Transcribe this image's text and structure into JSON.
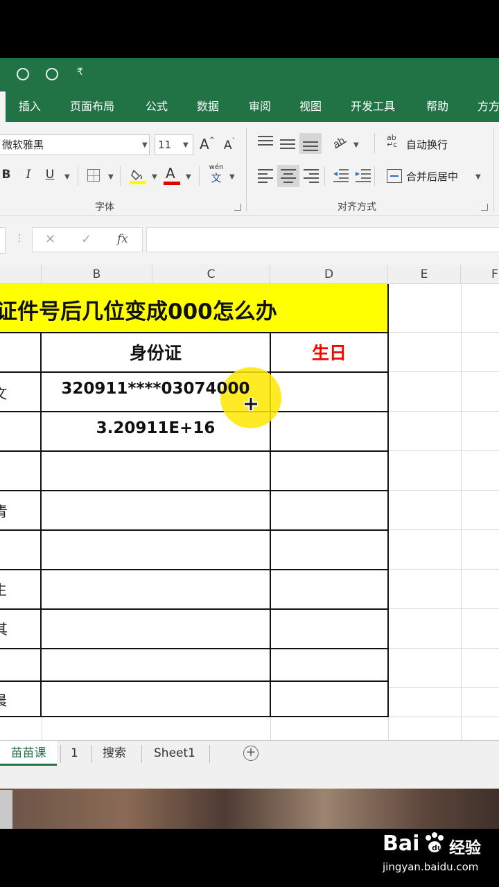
{
  "titlebar": {
    "quick_access_more": "₹"
  },
  "ribbon_tabs": [
    "插入",
    "页面布局",
    "公式",
    "数据",
    "审阅",
    "视图",
    "开发工具",
    "帮助",
    "方方"
  ],
  "font_group": {
    "font_name": "微软雅黑",
    "font_size": "11",
    "grow_font": "A",
    "shrink_font": "A",
    "bold": "B",
    "italic": "I",
    "underline": "U",
    "font_color_glyph": "A",
    "phonetic_top": "wén",
    "phonetic_bottom": "文",
    "label": "字体"
  },
  "alignment_group": {
    "wrap_text_label": "自动换行",
    "merge_center_label": "合并后居中",
    "label": "对齐方式"
  },
  "formula_bar": {
    "cancel": "✕",
    "enter": "✓",
    "fx": "fx",
    "value": ""
  },
  "columns": [
    "B",
    "C",
    "D",
    "E",
    "F"
  ],
  "sheet": {
    "title": "证件号后几位变成000怎么办",
    "header_id": "身份证",
    "header_birthday": "生日",
    "id_value_1": "320911****03074000",
    "id_value_2": "3.20911E+16",
    "row_label_fragments": [
      "文",
      "青",
      "生",
      "其",
      "晨"
    ]
  },
  "colors": {
    "excel_green": "#217346",
    "title_fill": "#ffff00",
    "birthday_red": "#ff0000",
    "cursor_highlight": "#ffe600"
  },
  "sheet_tabs": {
    "active": "苗苗课",
    "others": [
      "1",
      "搜索",
      "Sheet1"
    ],
    "add": "+"
  },
  "watermark": {
    "brand": "Bai",
    "brand_suffix": "经验",
    "url": "jingyan.baidu.com"
  }
}
